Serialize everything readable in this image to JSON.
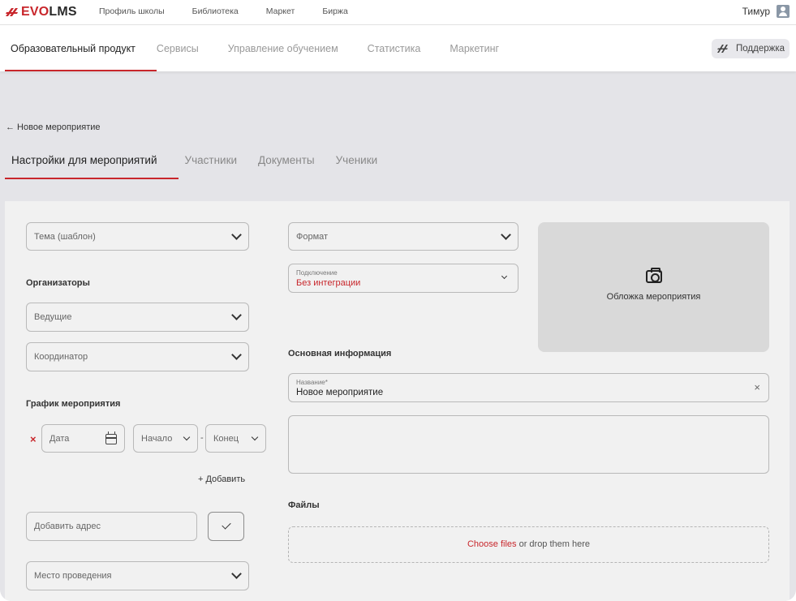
{
  "app": {
    "logo_evo": "EVO",
    "logo_lms": "LMS"
  },
  "topnav": {
    "items": [
      "Профиль школы",
      "Библиотека",
      "Маркет",
      "Биржа"
    ]
  },
  "user": {
    "name": "Тимур"
  },
  "secnav": {
    "items": [
      "Образовательный продукт",
      "Сервисы",
      "Управление обучением",
      "Статистика",
      "Маркетинг"
    ],
    "active": 0
  },
  "support": {
    "label": "Поддержка"
  },
  "back": {
    "label": "← Новое мероприятие"
  },
  "tabs": {
    "items": [
      "Настройки для мероприятий",
      "Участники",
      "Документы",
      "Ученики"
    ],
    "active": 0
  },
  "form": {
    "theme_placeholder": "Тема (шаблон)",
    "format_placeholder": "Формат",
    "connection_label": "Подключение",
    "connection_value": "Без интеграции",
    "cover_label": "Обложка мероприятия",
    "organizers_heading": "Организаторы",
    "hosts_placeholder": "Ведущие",
    "coordinator_placeholder": "Координатор",
    "main_info_heading": "Основная информация",
    "name_label": "Название*",
    "name_value": "Новое мероприятие",
    "schedule_heading": "График мероприятия",
    "date_placeholder": "Дата",
    "start_placeholder": "Начало",
    "dash": "-",
    "end_placeholder": "Конец",
    "add_label": "+ Добавить",
    "address_placeholder": "Добавить адрес",
    "venue_placeholder": "Место проведения",
    "files_heading": "Файлы",
    "dropzone_link": "Choose files",
    "dropzone_text": " or drop them here"
  },
  "colors": {
    "accent": "#c8262b",
    "panel": "#f1f1f1",
    "background": "#e4e4e8"
  }
}
